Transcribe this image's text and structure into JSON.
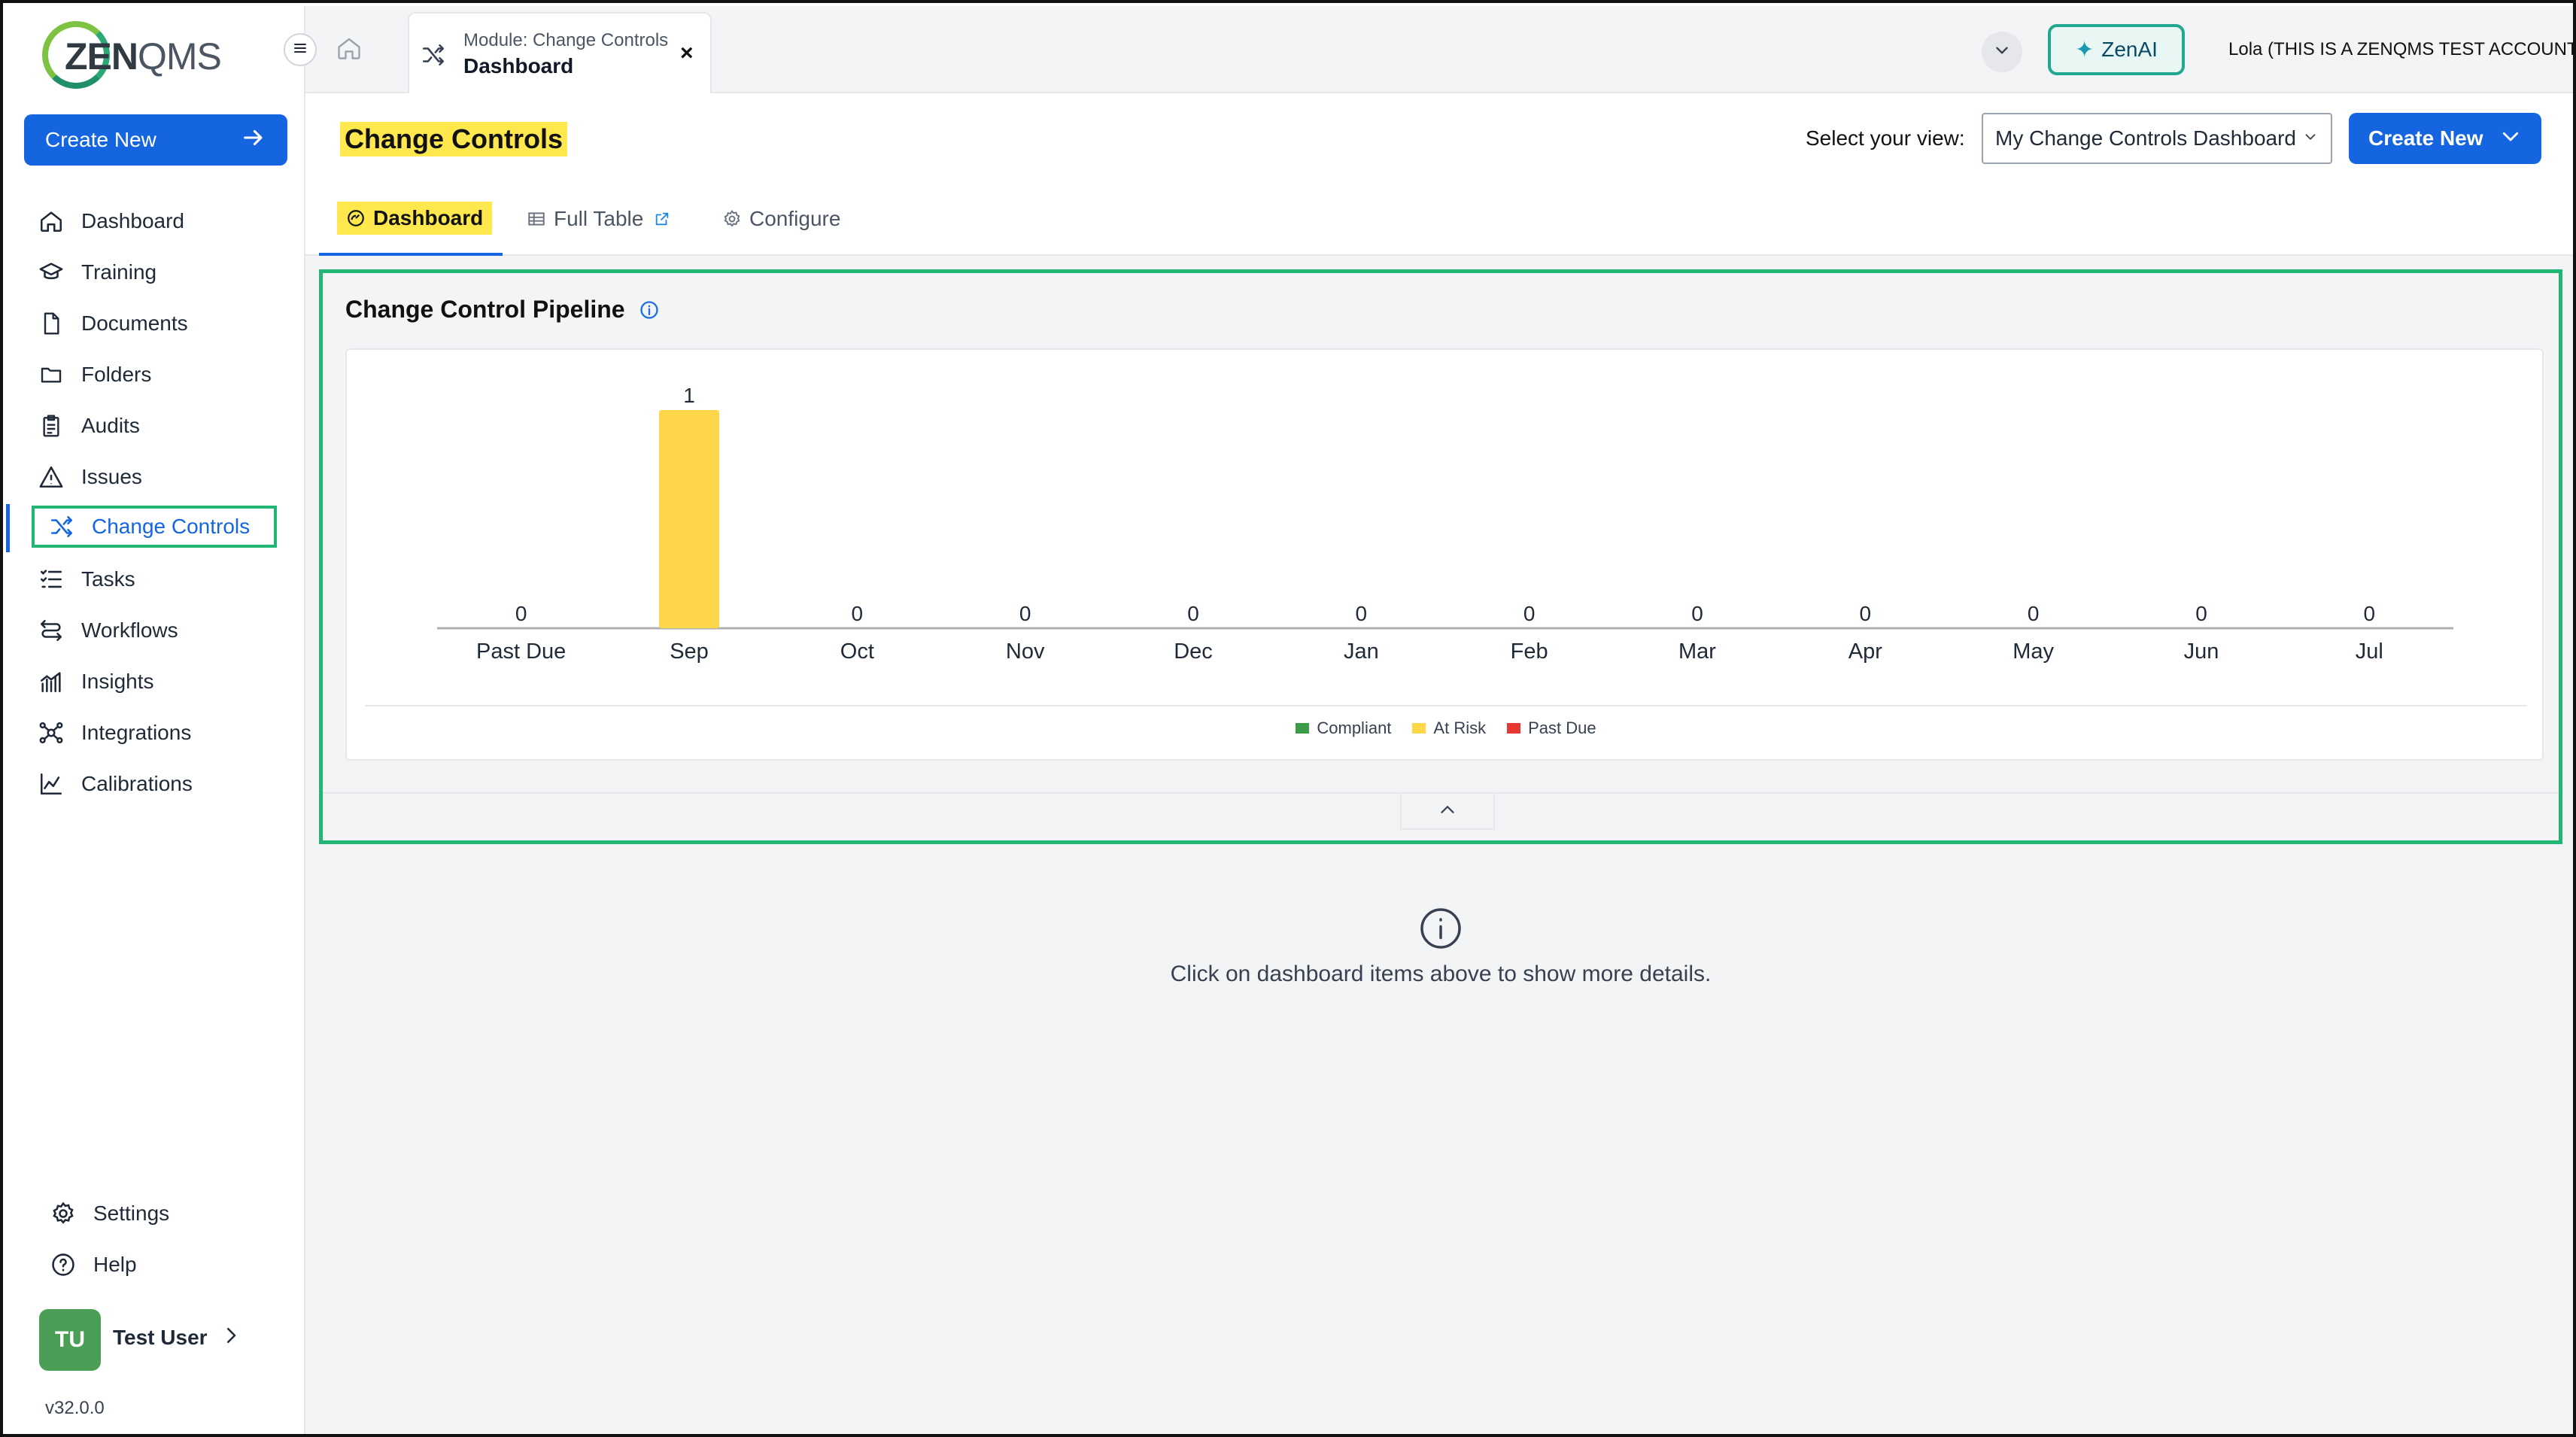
{
  "app": {
    "logo_text_bold": "ZEN",
    "logo_text_light": "QMS",
    "account_label": "Lola (THIS IS A ZENQMS TEST ACCOUNT)",
    "zenai_label": "ZenAI"
  },
  "sidebar": {
    "create_new_label": "Create New",
    "items": [
      {
        "label": "Dashboard",
        "icon": "home-icon"
      },
      {
        "label": "Training",
        "icon": "graduation-cap-icon"
      },
      {
        "label": "Documents",
        "icon": "document-icon"
      },
      {
        "label": "Folders",
        "icon": "folder-icon"
      },
      {
        "label": "Audits",
        "icon": "clipboard-icon"
      },
      {
        "label": "Issues",
        "icon": "warning-icon"
      },
      {
        "label": "Change Controls",
        "icon": "shuffle-icon",
        "active": true
      },
      {
        "label": "Tasks",
        "icon": "checklist-icon"
      },
      {
        "label": "Workflows",
        "icon": "workflow-icon"
      },
      {
        "label": "Insights",
        "icon": "bar-chart-icon"
      },
      {
        "label": "Integrations",
        "icon": "network-icon"
      },
      {
        "label": "Calibrations",
        "icon": "line-chart-icon"
      }
    ],
    "settings_label": "Settings",
    "help_label": "Help",
    "user_initials": "TU",
    "user_name": "Test User",
    "version": "v32.0.0"
  },
  "topbar": {
    "tab_module": "Module: Change Controls",
    "tab_title": "Dashboard",
    "tab_close": "×"
  },
  "main": {
    "title": "Change Controls",
    "view_label": "Select your view:",
    "view_selected": "My Change Controls Dashboard",
    "create_new_label": "Create New",
    "tabs": [
      {
        "label": "Dashboard",
        "active": true
      },
      {
        "label": "Full Table"
      },
      {
        "label": "Configure"
      }
    ],
    "pipeline_title": "Change Control Pipeline",
    "empty_state_text": "Click on dashboard items above to show more details."
  },
  "chart_data": {
    "type": "bar",
    "categories": [
      "Past Due",
      "Sep",
      "Oct",
      "Nov",
      "Dec",
      "Jan",
      "Feb",
      "Mar",
      "Apr",
      "May",
      "Jun",
      "Jul"
    ],
    "series": [
      {
        "name": "Compliant",
        "color": "#3a9b48",
        "values": [
          0,
          0,
          0,
          0,
          0,
          0,
          0,
          0,
          0,
          0,
          0,
          0
        ]
      },
      {
        "name": "At Risk",
        "color": "#ffd54a",
        "values": [
          0,
          1,
          0,
          0,
          0,
          0,
          0,
          0,
          0,
          0,
          0,
          0
        ]
      },
      {
        "name": "Past Due",
        "color": "#e53935",
        "values": [
          0,
          0,
          0,
          0,
          0,
          0,
          0,
          0,
          0,
          0,
          0,
          0
        ]
      }
    ],
    "totals": [
      0,
      1,
      0,
      0,
      0,
      0,
      0,
      0,
      0,
      0,
      0,
      0
    ],
    "legend_position": "bottom",
    "grid": false
  }
}
